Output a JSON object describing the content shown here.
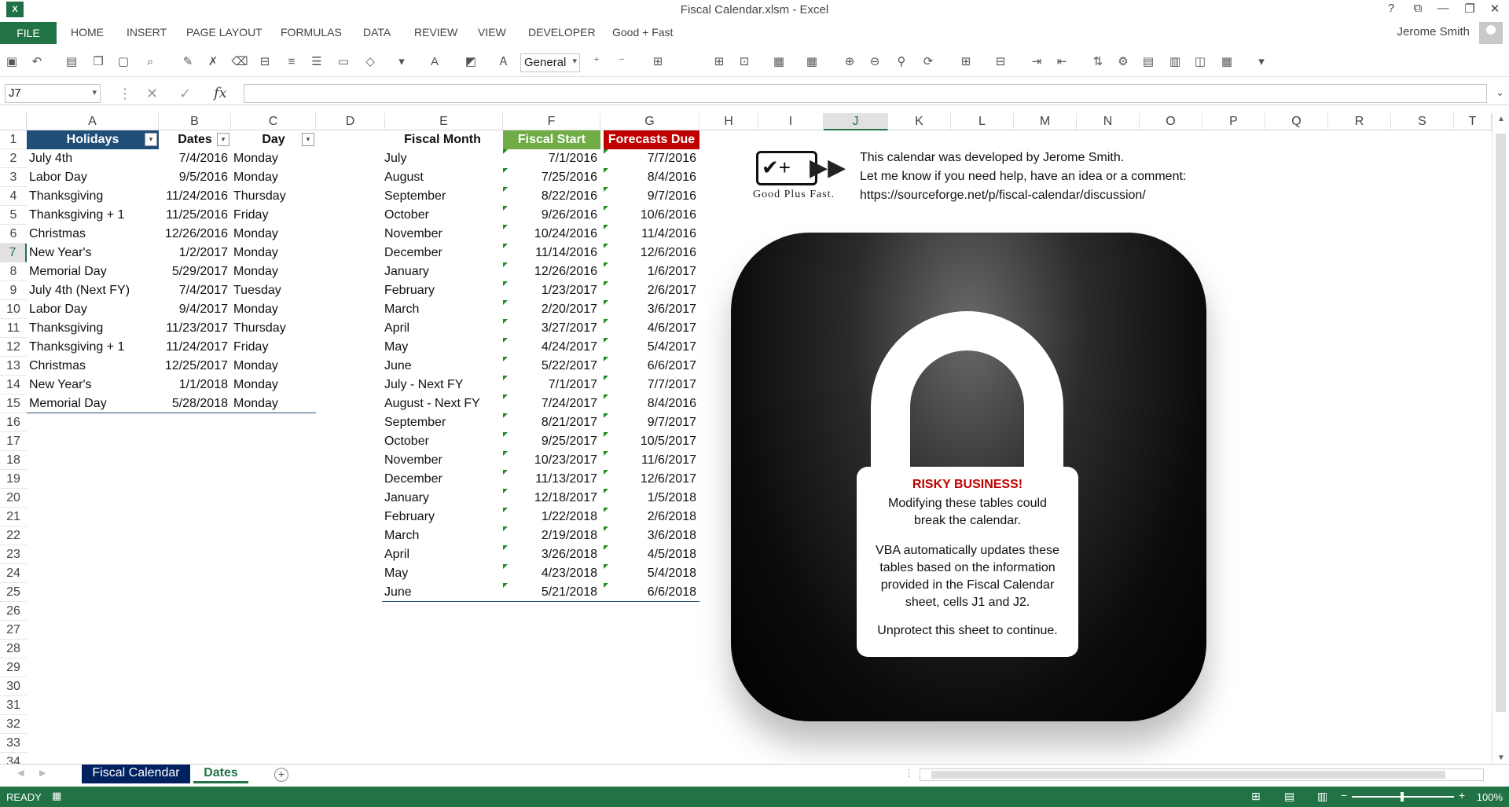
{
  "window": {
    "title": "Fiscal Calendar.xlsm - Excel",
    "controls": [
      "?",
      "⧉",
      "—",
      "❐",
      "✕"
    ]
  },
  "ribbon": {
    "file": "FILE",
    "tabs": [
      "HOME",
      "INSERT",
      "PAGE LAYOUT",
      "FORMULAS",
      "DATA",
      "REVIEW",
      "VIEW",
      "DEVELOPER",
      "Good + Fast"
    ],
    "user": "Jerome Smith"
  },
  "toolbar": {
    "number_format": "General"
  },
  "formula_bar": {
    "name_box": "J7",
    "fx": "fx",
    "formula": ""
  },
  "columns": [
    "A",
    "B",
    "C",
    "D",
    "E",
    "F",
    "G",
    "H",
    "I",
    "J",
    "K",
    "L",
    "M",
    "N",
    "O",
    "P",
    "Q",
    "R",
    "S",
    "T"
  ],
  "rows": [
    "1",
    "2",
    "3",
    "4",
    "5",
    "6",
    "7",
    "8",
    "9",
    "10",
    "11",
    "12",
    "13",
    "14",
    "15",
    "16",
    "17",
    "18",
    "19",
    "20",
    "21",
    "22",
    "23",
    "24",
    "25",
    "26",
    "27",
    "28",
    "29",
    "30",
    "31",
    "32",
    "33",
    "34"
  ],
  "holidays": {
    "headers": [
      "Holidays",
      "Dates",
      "Day"
    ],
    "rows": [
      [
        "July 4th",
        "7/4/2016",
        "Monday"
      ],
      [
        "Labor Day",
        "9/5/2016",
        "Monday"
      ],
      [
        "Thanksgiving",
        "11/24/2016",
        "Thursday"
      ],
      [
        "Thanksgiving + 1",
        "11/25/2016",
        "Friday"
      ],
      [
        "Christmas",
        "12/26/2016",
        "Monday"
      ],
      [
        "New Year's",
        "1/2/2017",
        "Monday"
      ],
      [
        "Memorial Day",
        "5/29/2017",
        "Monday"
      ],
      [
        "July 4th (Next FY)",
        "7/4/2017",
        "Tuesday"
      ],
      [
        "Labor Day",
        "9/4/2017",
        "Monday"
      ],
      [
        "Thanksgiving",
        "11/23/2017",
        "Thursday"
      ],
      [
        "Thanksgiving + 1",
        "11/24/2017",
        "Friday"
      ],
      [
        "Christmas",
        "12/25/2017",
        "Monday"
      ],
      [
        "New Year's",
        "1/1/2018",
        "Monday"
      ],
      [
        "Memorial Day",
        "5/28/2018",
        "Monday"
      ]
    ]
  },
  "fiscal": {
    "headers": [
      "Fiscal Month",
      "Fiscal Start",
      "Forecasts Due"
    ],
    "rows": [
      [
        "July",
        "7/1/2016",
        "7/7/2016"
      ],
      [
        "August",
        "7/25/2016",
        "8/4/2016"
      ],
      [
        "September",
        "8/22/2016",
        "9/7/2016"
      ],
      [
        "October",
        "9/26/2016",
        "10/6/2016"
      ],
      [
        "November",
        "10/24/2016",
        "11/4/2016"
      ],
      [
        "December",
        "11/14/2016",
        "12/6/2016"
      ],
      [
        "January",
        "12/26/2016",
        "1/6/2017"
      ],
      [
        "February",
        "1/23/2017",
        "2/6/2017"
      ],
      [
        "March",
        "2/20/2017",
        "3/6/2017"
      ],
      [
        "April",
        "3/27/2017",
        "4/6/2017"
      ],
      [
        "May",
        "4/24/2017",
        "5/4/2017"
      ],
      [
        "June",
        "5/22/2017",
        "6/6/2017"
      ],
      [
        "July - Next FY",
        "7/1/2017",
        "7/7/2017"
      ],
      [
        "August - Next FY",
        "7/24/2017",
        "8/4/2016"
      ],
      [
        "September",
        "8/21/2017",
        "9/7/2017"
      ],
      [
        "October",
        "9/25/2017",
        "10/5/2017"
      ],
      [
        "November",
        "10/23/2017",
        "11/6/2017"
      ],
      [
        "December",
        "11/13/2017",
        "12/6/2017"
      ],
      [
        "January",
        "12/18/2017",
        "1/5/2018"
      ],
      [
        "February",
        "1/22/2018",
        "2/6/2018"
      ],
      [
        "March",
        "2/19/2018",
        "3/6/2018"
      ],
      [
        "April",
        "3/26/2018",
        "4/5/2018"
      ],
      [
        "May",
        "4/23/2018",
        "5/4/2018"
      ],
      [
        "June",
        "5/21/2018",
        "6/6/2018"
      ]
    ]
  },
  "info": {
    "logo_text": "Good Plus Fast.",
    "lines": [
      "This calendar was developed by Jerome Smith.",
      "Let me know if you need help, have an idea or a comment:",
      "https://sourceforge.net/p/fiscal-calendar/discussion/"
    ]
  },
  "lock": {
    "heading": "RISKY BUSINESS!",
    "line1": "Modifying these tables could break the calendar.",
    "line2": "VBA automatically updates these tables based on the information provided in the Fiscal Calendar sheet, cells J1 and J2.",
    "line3": "Unprotect this sheet to continue."
  },
  "sheets": {
    "tabs": [
      "Fiscal Calendar",
      "Dates"
    ],
    "active": "Dates"
  },
  "status": {
    "ready": "READY",
    "zoom": "100%"
  },
  "colors": {
    "excel_green": "#217346",
    "table_blue": "#1f4e79",
    "fiscal_green": "#70ad47",
    "forecast_red": "#c00000"
  }
}
